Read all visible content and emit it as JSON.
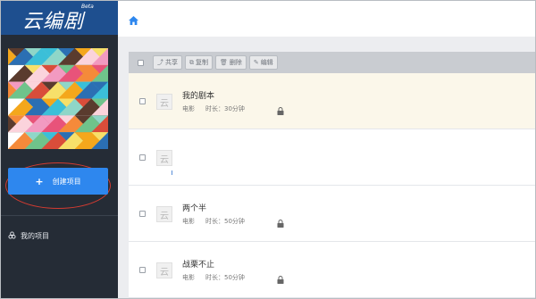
{
  "app": {
    "logo_text": "云编剧",
    "logo_badge": "Beta"
  },
  "sidebar": {
    "create_button_label": "创建项目",
    "create_button_plus": "+",
    "my_projects_label": "我的项目"
  },
  "toolbar": {
    "share_label": "共享",
    "copy_label": "复制",
    "delete_label": "删除",
    "edit_label": "编辑"
  },
  "projects": [
    {
      "title": "我的剧本",
      "type": "电影",
      "duration": "时长：30分钟",
      "locked": true,
      "highlighted": true
    },
    {
      "title": "",
      "type": "",
      "duration": "",
      "locked": false,
      "highlighted": false
    },
    {
      "title": "两个半",
      "type": "电影",
      "duration": "时长：50分钟",
      "locked": true,
      "highlighted": false
    },
    {
      "title": "战栗不止",
      "type": "电影",
      "duration": "时长：50分钟",
      "locked": true,
      "highlighted": false
    }
  ],
  "icons": {
    "home": "home-icon",
    "lock": "lock-icon",
    "project": "project-icon",
    "folder": "folder-icon"
  },
  "colors": {
    "sidebar_bg": "#252c36",
    "logo_bg": "#1e4f8f",
    "accent": "#2e87ee",
    "annotation": "#d23b31"
  }
}
